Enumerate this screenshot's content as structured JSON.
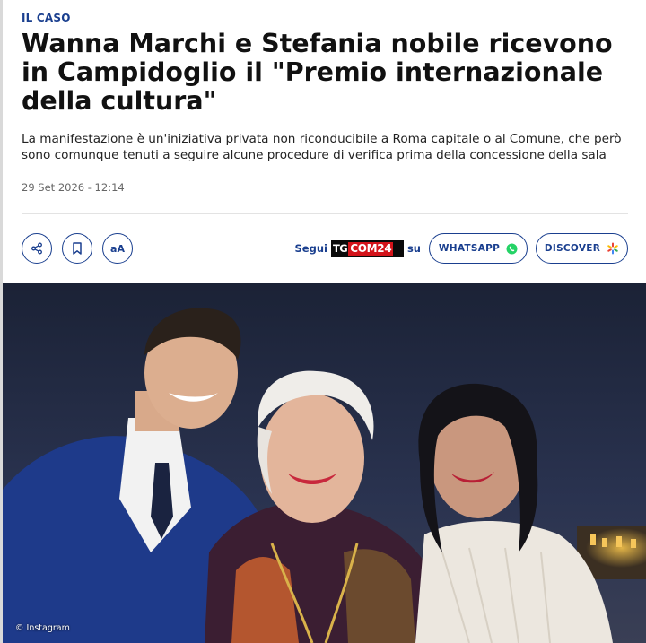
{
  "article": {
    "kicker": "IL CASO",
    "headline": "Wanna Marchi e Stefania nobile ricevono in Campidoglio il \"Premio internazionale della cultura\"",
    "summary": "La manifestazione è un'iniziativa privata non riconducibile a Roma capitale o al Comune, che però sono comunque tenuti a seguire alcune procedure di verifica prima della concessione della sala",
    "date": "29 Set 2026 - 12:14"
  },
  "toolbar": {
    "share_icon": "share-icon",
    "bookmark_icon": "bookmark-icon",
    "font_size_label": "aA"
  },
  "follow": {
    "prefix": "Segui",
    "brand_tg": "TG",
    "brand_com": "COM24",
    "suffix": "su",
    "whatsapp_label": "WHATSAPP",
    "discover_label": "DISCOVER"
  },
  "photo": {
    "credit": "© Instagram"
  },
  "colors": {
    "accent": "#1a3f8f",
    "whatsapp": "#25d366",
    "brand_red": "#d3131a"
  }
}
